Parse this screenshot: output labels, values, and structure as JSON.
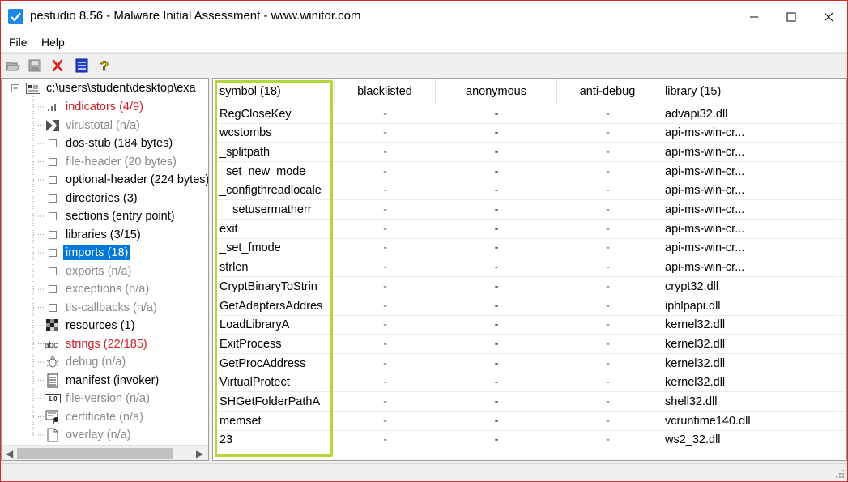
{
  "window": {
    "title": "pestudio 8.56 - Malware Initial Assessment - www.winitor.com",
    "accent_color": "#c9302c"
  },
  "menu": {
    "file": "File",
    "help": "Help"
  },
  "toolbar": {
    "buttons": [
      "open-folder-icon",
      "save-icon",
      "close-file-icon",
      "list-icon",
      "help-icon"
    ]
  },
  "tree": {
    "root": "c:\\users\\student\\desktop\\exa",
    "items": [
      {
        "label": "indicators (4/9)",
        "style": "red",
        "icon": "bar-chart-icon"
      },
      {
        "label": "virustotal (n/a)",
        "style": "gray",
        "icon": "virustotal-icon"
      },
      {
        "label": "dos-stub (184 bytes)",
        "style": "black",
        "icon": "box-icon"
      },
      {
        "label": "file-header (20 bytes)",
        "style": "gray",
        "icon": "box-icon"
      },
      {
        "label": "optional-header (224 bytes)",
        "style": "black",
        "icon": "box-icon"
      },
      {
        "label": "directories (3)",
        "style": "black",
        "icon": "box-icon"
      },
      {
        "label": "sections (entry point)",
        "style": "black",
        "icon": "box-icon"
      },
      {
        "label": "libraries (3/15)",
        "style": "black",
        "icon": "box-icon"
      },
      {
        "label": "imports (18)",
        "style": "selected",
        "icon": "box-icon"
      },
      {
        "label": "exports (n/a)",
        "style": "gray",
        "icon": "box-icon"
      },
      {
        "label": "exceptions (n/a)",
        "style": "gray",
        "icon": "box-icon"
      },
      {
        "label": "tls-callbacks (n/a)",
        "style": "gray",
        "icon": "box-icon"
      },
      {
        "label": "resources (1)",
        "style": "black",
        "icon": "resources-icon"
      },
      {
        "label": "strings (22/185)",
        "style": "red",
        "icon": "abc-icon"
      },
      {
        "label": "debug (n/a)",
        "style": "gray",
        "icon": "bug-icon"
      },
      {
        "label": "manifest (invoker)",
        "style": "black",
        "icon": "manifest-icon"
      },
      {
        "label": "file-version (n/a)",
        "style": "gray",
        "icon": "version-icon"
      },
      {
        "label": "certificate (n/a)",
        "style": "gray",
        "icon": "certificate-icon"
      },
      {
        "label": "overlay (n/a)",
        "style": "gray",
        "icon": "page-icon"
      }
    ]
  },
  "table": {
    "columns": [
      "symbol (18)",
      "blacklisted",
      "anonymous",
      "anti-debug",
      "library (15)"
    ],
    "rows": [
      [
        "RegCloseKey",
        "-",
        "-",
        "-",
        "advapi32.dll"
      ],
      [
        "wcstombs",
        "-",
        "-",
        "-",
        "api-ms-win-cr..."
      ],
      [
        "_splitpath",
        "-",
        "-",
        "-",
        "api-ms-win-cr..."
      ],
      [
        "_set_new_mode",
        "-",
        "-",
        "-",
        "api-ms-win-cr..."
      ],
      [
        "_configthreadlocale",
        "-",
        "-",
        "-",
        "api-ms-win-cr..."
      ],
      [
        "__setusermatherr",
        "-",
        "-",
        "-",
        "api-ms-win-cr..."
      ],
      [
        "exit",
        "-",
        "-",
        "-",
        "api-ms-win-cr..."
      ],
      [
        "_set_fmode",
        "-",
        "-",
        "-",
        "api-ms-win-cr..."
      ],
      [
        "strlen",
        "-",
        "-",
        "-",
        "api-ms-win-cr..."
      ],
      [
        "CryptBinaryToStrin",
        "-",
        "-",
        "-",
        "crypt32.dll"
      ],
      [
        "GetAdaptersAddres",
        "-",
        "-",
        "-",
        "iphlpapi.dll"
      ],
      [
        "LoadLibraryA",
        "-",
        "-",
        "-",
        "kernel32.dll"
      ],
      [
        "ExitProcess",
        "-",
        "-",
        "-",
        "kernel32.dll"
      ],
      [
        "GetProcAddress",
        "-",
        "-",
        "-",
        "kernel32.dll"
      ],
      [
        "VirtualProtect",
        "-",
        "-",
        "-",
        "kernel32.dll"
      ],
      [
        "SHGetFolderPathA",
        "-",
        "-",
        "-",
        "shell32.dll"
      ],
      [
        "memset",
        "-",
        "-",
        "-",
        "vcruntime140.dll"
      ],
      [
        "23",
        "-",
        "-",
        "-",
        "ws2_32.dll"
      ]
    ],
    "highlight_color": "#b4d63c"
  }
}
